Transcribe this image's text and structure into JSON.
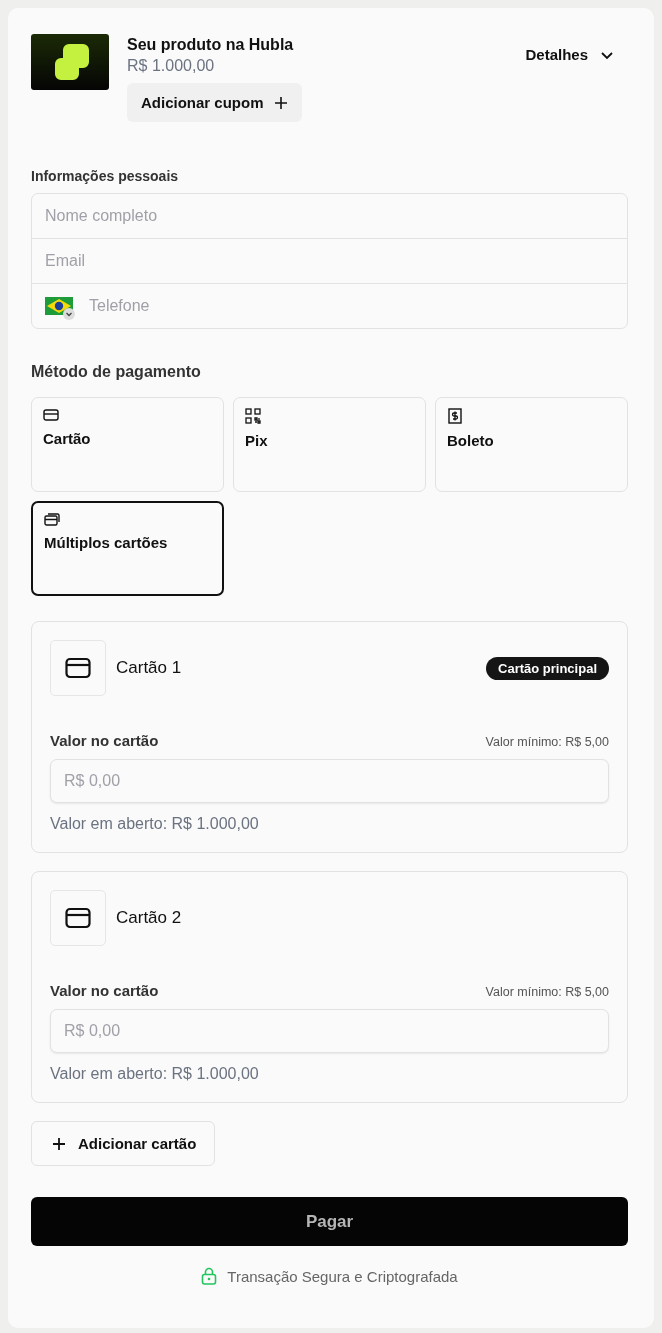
{
  "product": {
    "name": "Seu produto na Hubla",
    "price": "R$ 1.000,00",
    "coupon_button": "Adicionar cupom",
    "details_button": "Detalhes",
    "expanded": false
  },
  "personal_info": {
    "title": "Informações pessoais",
    "fields": [
      {
        "kind": "text",
        "placeholder": "Nome completo"
      },
      {
        "kind": "text",
        "placeholder": "Email"
      },
      {
        "kind": "phone",
        "placeholder": "Telefone"
      }
    ]
  },
  "payment": {
    "title": "Método de pagamento",
    "methods": [
      {
        "kind": "card",
        "label": "Cartão",
        "selected": false
      },
      {
        "kind": "pix",
        "label": "Pix",
        "selected": false
      },
      {
        "kind": "boleto",
        "label": "Boleto",
        "selected": false
      },
      {
        "kind": "multi",
        "label": "Múltiplos cartões",
        "selected": true
      }
    ]
  },
  "cards": [
    {
      "title": "Cartão 1",
      "badge": "Cartão principal",
      "amount_label": "Valor no cartão",
      "minimum": "Valor mínimo: R$ 5,00",
      "placeholder": "R$ 0,00",
      "open_amount": "Valor em aberto: R$ 1.000,00"
    },
    {
      "title": "Cartão 2",
      "amount_label": "Valor no cartão",
      "minimum": "Valor mínimo: R$ 5,00",
      "placeholder": "R$ 0,00",
      "open_amount": "Valor em aberto: R$ 1.000,00"
    }
  ],
  "add_card_button": "Adicionar cartão",
  "pay_button": {
    "label": "Pagar",
    "disabled": true
  },
  "security_note": "Transação Segura e Criptografada"
}
